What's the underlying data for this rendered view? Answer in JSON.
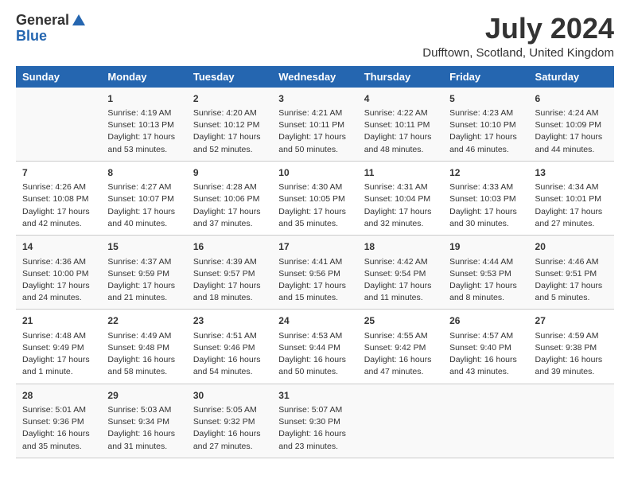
{
  "header": {
    "logo_general": "General",
    "logo_blue": "Blue",
    "month_title": "July 2024",
    "location": "Dufftown, Scotland, United Kingdom"
  },
  "weekdays": [
    "Sunday",
    "Monday",
    "Tuesday",
    "Wednesday",
    "Thursday",
    "Friday",
    "Saturday"
  ],
  "weeks": [
    [
      {
        "day": "",
        "text": ""
      },
      {
        "day": "1",
        "text": "Sunrise: 4:19 AM\nSunset: 10:13 PM\nDaylight: 17 hours\nand 53 minutes."
      },
      {
        "day": "2",
        "text": "Sunrise: 4:20 AM\nSunset: 10:12 PM\nDaylight: 17 hours\nand 52 minutes."
      },
      {
        "day": "3",
        "text": "Sunrise: 4:21 AM\nSunset: 10:11 PM\nDaylight: 17 hours\nand 50 minutes."
      },
      {
        "day": "4",
        "text": "Sunrise: 4:22 AM\nSunset: 10:11 PM\nDaylight: 17 hours\nand 48 minutes."
      },
      {
        "day": "5",
        "text": "Sunrise: 4:23 AM\nSunset: 10:10 PM\nDaylight: 17 hours\nand 46 minutes."
      },
      {
        "day": "6",
        "text": "Sunrise: 4:24 AM\nSunset: 10:09 PM\nDaylight: 17 hours\nand 44 minutes."
      }
    ],
    [
      {
        "day": "7",
        "text": "Sunrise: 4:26 AM\nSunset: 10:08 PM\nDaylight: 17 hours\nand 42 minutes."
      },
      {
        "day": "8",
        "text": "Sunrise: 4:27 AM\nSunset: 10:07 PM\nDaylight: 17 hours\nand 40 minutes."
      },
      {
        "day": "9",
        "text": "Sunrise: 4:28 AM\nSunset: 10:06 PM\nDaylight: 17 hours\nand 37 minutes."
      },
      {
        "day": "10",
        "text": "Sunrise: 4:30 AM\nSunset: 10:05 PM\nDaylight: 17 hours\nand 35 minutes."
      },
      {
        "day": "11",
        "text": "Sunrise: 4:31 AM\nSunset: 10:04 PM\nDaylight: 17 hours\nand 32 minutes."
      },
      {
        "day": "12",
        "text": "Sunrise: 4:33 AM\nSunset: 10:03 PM\nDaylight: 17 hours\nand 30 minutes."
      },
      {
        "day": "13",
        "text": "Sunrise: 4:34 AM\nSunset: 10:01 PM\nDaylight: 17 hours\nand 27 minutes."
      }
    ],
    [
      {
        "day": "14",
        "text": "Sunrise: 4:36 AM\nSunset: 10:00 PM\nDaylight: 17 hours\nand 24 minutes."
      },
      {
        "day": "15",
        "text": "Sunrise: 4:37 AM\nSunset: 9:59 PM\nDaylight: 17 hours\nand 21 minutes."
      },
      {
        "day": "16",
        "text": "Sunrise: 4:39 AM\nSunset: 9:57 PM\nDaylight: 17 hours\nand 18 minutes."
      },
      {
        "day": "17",
        "text": "Sunrise: 4:41 AM\nSunset: 9:56 PM\nDaylight: 17 hours\nand 15 minutes."
      },
      {
        "day": "18",
        "text": "Sunrise: 4:42 AM\nSunset: 9:54 PM\nDaylight: 17 hours\nand 11 minutes."
      },
      {
        "day": "19",
        "text": "Sunrise: 4:44 AM\nSunset: 9:53 PM\nDaylight: 17 hours\nand 8 minutes."
      },
      {
        "day": "20",
        "text": "Sunrise: 4:46 AM\nSunset: 9:51 PM\nDaylight: 17 hours\nand 5 minutes."
      }
    ],
    [
      {
        "day": "21",
        "text": "Sunrise: 4:48 AM\nSunset: 9:49 PM\nDaylight: 17 hours\nand 1 minute."
      },
      {
        "day": "22",
        "text": "Sunrise: 4:49 AM\nSunset: 9:48 PM\nDaylight: 16 hours\nand 58 minutes."
      },
      {
        "day": "23",
        "text": "Sunrise: 4:51 AM\nSunset: 9:46 PM\nDaylight: 16 hours\nand 54 minutes."
      },
      {
        "day": "24",
        "text": "Sunrise: 4:53 AM\nSunset: 9:44 PM\nDaylight: 16 hours\nand 50 minutes."
      },
      {
        "day": "25",
        "text": "Sunrise: 4:55 AM\nSunset: 9:42 PM\nDaylight: 16 hours\nand 47 minutes."
      },
      {
        "day": "26",
        "text": "Sunrise: 4:57 AM\nSunset: 9:40 PM\nDaylight: 16 hours\nand 43 minutes."
      },
      {
        "day": "27",
        "text": "Sunrise: 4:59 AM\nSunset: 9:38 PM\nDaylight: 16 hours\nand 39 minutes."
      }
    ],
    [
      {
        "day": "28",
        "text": "Sunrise: 5:01 AM\nSunset: 9:36 PM\nDaylight: 16 hours\nand 35 minutes."
      },
      {
        "day": "29",
        "text": "Sunrise: 5:03 AM\nSunset: 9:34 PM\nDaylight: 16 hours\nand 31 minutes."
      },
      {
        "day": "30",
        "text": "Sunrise: 5:05 AM\nSunset: 9:32 PM\nDaylight: 16 hours\nand 27 minutes."
      },
      {
        "day": "31",
        "text": "Sunrise: 5:07 AM\nSunset: 9:30 PM\nDaylight: 16 hours\nand 23 minutes."
      },
      {
        "day": "",
        "text": ""
      },
      {
        "day": "",
        "text": ""
      },
      {
        "day": "",
        "text": ""
      }
    ]
  ]
}
